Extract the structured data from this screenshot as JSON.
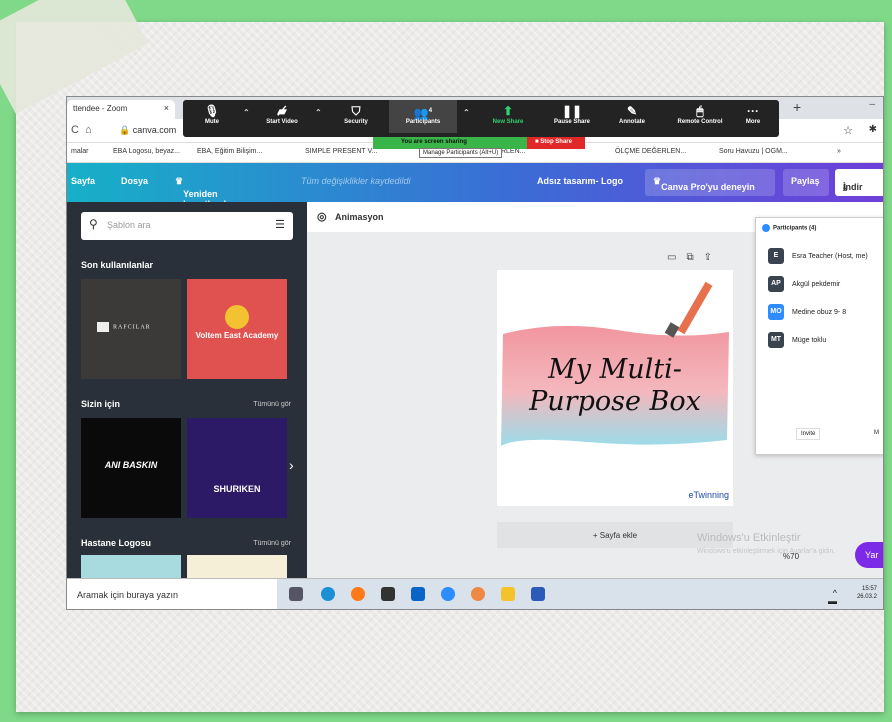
{
  "browser": {
    "tab_title": "ttendee - Zoom",
    "tab_close": "×",
    "new_tab": "+",
    "url": "canva.com",
    "bookmarks": [
      "malar",
      "EBA Logosu, beyaz...",
      "EBA, Eğitim Bilişim...",
      "SIMPLE PRESENT V...",
      "BİÇME DEĞERLEN...",
      "ÖLÇME DEĞERLEN...",
      "Soru Havuzu | OGM..."
    ],
    "bookmarks_more": "»"
  },
  "zoom": {
    "buttons": [
      {
        "label": "Mute",
        "icon": "mic-icon"
      },
      {
        "label": "Start Video",
        "icon": "video-off-icon"
      },
      {
        "label": "Security",
        "icon": "shield-icon"
      },
      {
        "label": "Participants",
        "icon": "participants-icon",
        "count": "4"
      },
      {
        "label": "New Share",
        "icon": "share-icon"
      },
      {
        "label": "Pause Share",
        "icon": "pause-icon"
      },
      {
        "label": "Annotate",
        "icon": "pen-icon"
      },
      {
        "label": "Remote Control",
        "icon": "mouse-icon"
      },
      {
        "label": "More",
        "icon": "more-icon"
      }
    ],
    "sharing_text": "You are screen sharing",
    "stop_share": "Stop Share",
    "tooltip": "Manage Participants (Alt+U)"
  },
  "canva": {
    "menu": [
      "Sayfa",
      "Dosya",
      "Yeniden boyutlandır"
    ],
    "saved": "Tüm değişiklikler kaydedildi",
    "design_name": "Adsız tasarım- Logo",
    "pro_button": "Canva Pro'yu deneyin",
    "share_button": "Paylaş",
    "download_button": "İndir",
    "search_placeholder": "Şablon ara",
    "recent": "Son kullanılanlar",
    "for_you": "Sizin için",
    "see_all_1": "Tümünü gör",
    "hospital": "Hastane Logosu",
    "see_all_2": "Tümünü gör",
    "thumbs": {
      "rafc": "RAFCILAR",
      "volt": "Voltem East Academy",
      "ani": "ANI BASKIN",
      "shur": "SHURIKEN"
    },
    "animation": "Animasyon",
    "design_title": "My Multi-Purpose Box",
    "etwinning": "eTwinning",
    "add_page": "+ Sayfa ekle",
    "zoom_pct": "%70",
    "help": "Yar"
  },
  "windows": {
    "activate": "Windows'u Etkinleştir",
    "activate_sub": "Windows'u etkinleştirmek için Ayarlar'a gidin.",
    "search": "Aramak için buraya yazın",
    "time": "15:57",
    "date": "26.03.2"
  },
  "participants": {
    "header": "Participants (4)",
    "list": [
      {
        "initials": "E",
        "name": "Esra Teacher (Host, me)",
        "color": "#3a4450"
      },
      {
        "initials": "AP",
        "name": "Akgül pekdemir",
        "color": "#3a4450"
      },
      {
        "initials": "MO",
        "name": "Medine obuz 9- 8",
        "color": "#2d8cff"
      },
      {
        "initials": "MT",
        "name": "Müge toklu",
        "color": "#3a4450"
      }
    ],
    "invite": "Invite",
    "mute": "M"
  }
}
